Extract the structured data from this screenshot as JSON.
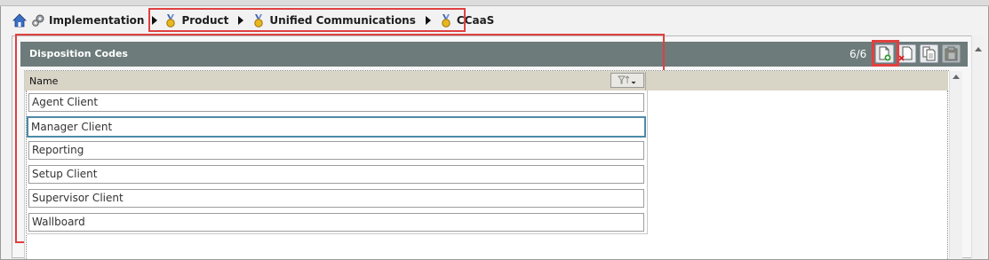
{
  "breadcrumb": {
    "items": [
      {
        "label": "Implementation",
        "icon": "gears-icon"
      },
      {
        "label": "Product",
        "icon": "medal-icon"
      },
      {
        "label": "Unified Communications",
        "icon": "medal-icon"
      },
      {
        "label": "CCaaS",
        "icon": "medal-icon"
      }
    ]
  },
  "panel": {
    "title": "Disposition Codes",
    "count": "6/6",
    "toolbar": [
      "add-document-icon",
      "delete-document-icon",
      "copy-document-icon",
      "paste-icon"
    ]
  },
  "grid": {
    "column": "Name",
    "filter_icon": "filter-sort-icon",
    "rows": [
      {
        "label": "Agent Client",
        "selected": false
      },
      {
        "label": "Manager Client",
        "selected": true
      },
      {
        "label": "Reporting",
        "selected": false
      },
      {
        "label": "Setup Client",
        "selected": false
      },
      {
        "label": "Supervisor Client",
        "selected": false
      },
      {
        "label": "Wallboard",
        "selected": false
      }
    ]
  },
  "colors": {
    "panel_header": "#6d7b7b",
    "highlight": "#e04040",
    "selection": "#4d8aa8"
  }
}
